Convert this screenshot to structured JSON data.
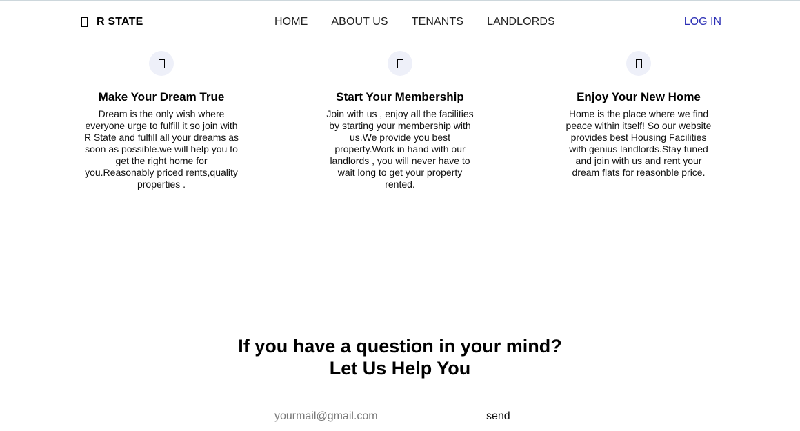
{
  "header": {
    "brand_icon": "home-icon",
    "brand_name": "R STATE",
    "nav": [
      {
        "label": "HOME"
      },
      {
        "label": "ABOUT US"
      },
      {
        "label": "TENANTS"
      },
      {
        "label": "LANDLORDS"
      }
    ],
    "login_label": "LOG IN",
    "login_color": "#2b2fb5"
  },
  "features": [
    {
      "icon": "feature-icon",
      "title": "Make Your Dream True",
      "body": "Dream is the only wish where everyone urge to fulfill it so join with R State and fulfill all your dreams as soon as possible.we will help you to get the right home for you.Reasonably priced rents,quality properties ."
    },
    {
      "icon": "feature-icon",
      "title": "Start Your Membership",
      "body": "Join with us , enjoy all the facilities by starting your membership with us.We provide you best property.Work in hand with our landlords , you will never have to wait long to get your property rented."
    },
    {
      "icon": "feature-icon",
      "title": "Enjoy Your New Home",
      "body": "Home is the place where we find peace within itself! So our website provides best Housing Facilities with genius landlords.Stay tuned and join with us and rent your dream flats for reasonble price."
    }
  ],
  "question": {
    "line1": "If you have a question in your mind?",
    "line2": "Let Us Help You"
  },
  "subscribe": {
    "email_placeholder": "yourmail@gmail.com",
    "send_label": "send"
  },
  "colors": {
    "icon_circle_bg": "#eef0f9",
    "top_rule": "#cdd7dc"
  }
}
